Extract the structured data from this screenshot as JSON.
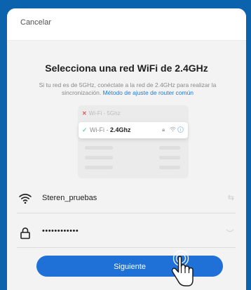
{
  "header": {
    "cancel_label": "Cancelar"
  },
  "main": {
    "title": "Selecciona una red WiFi de 2.4GHz",
    "subtitle": "Si tu red es de 5GHz, conéctate a la red de 2.4GHz para realizar la sincronización.",
    "subtitle_link": "Método de ajuste de router común"
  },
  "illustration": {
    "row1_prefix": "Wi-Fi - ",
    "row1_band": "5Ghz",
    "row2_prefix": "Wi-Fi - ",
    "row2_band": "2.4Ghz",
    "icons": [
      "lock-icon",
      "wifi-icon",
      "info-icon"
    ]
  },
  "form": {
    "network_value": "Steren_pruebas",
    "password_value": "••••••••••••"
  },
  "actions": {
    "next_label": "Siguiente"
  },
  "colors": {
    "background": "#0b63ad",
    "accent": "#1f71d8",
    "link": "#1f79d6",
    "success": "#3ac06c",
    "error": "#e25555"
  }
}
